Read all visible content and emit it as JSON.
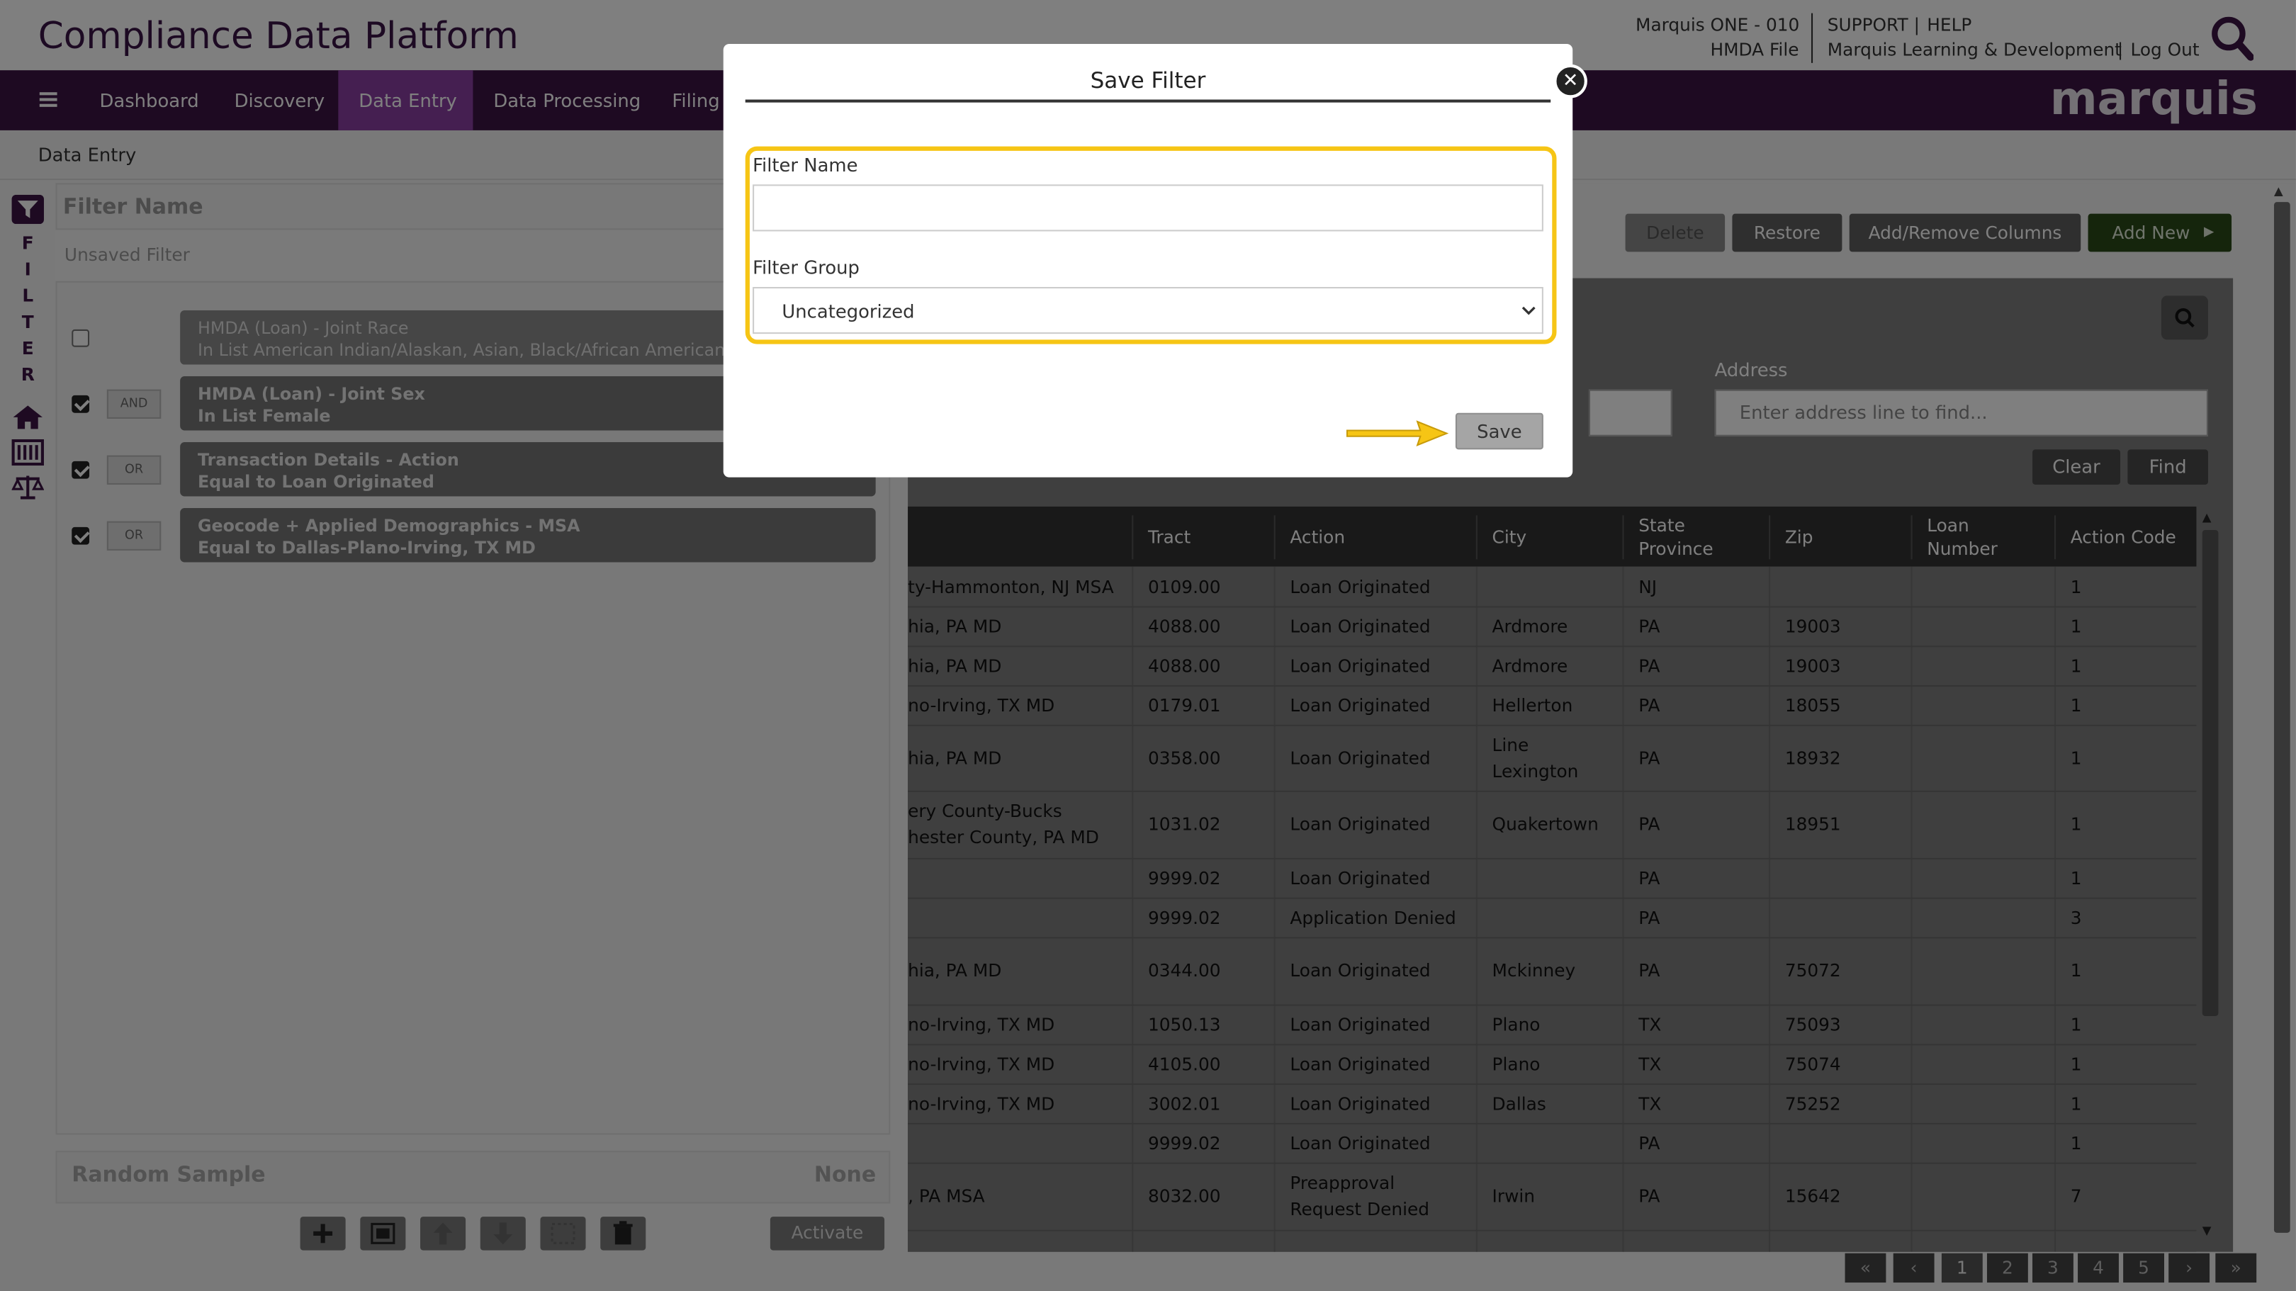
{
  "header": {
    "app_title": "Compliance Data Platform",
    "company": "Marquis ONE - 010",
    "file": "HMDA File",
    "support": "SUPPORT",
    "sep1": "|",
    "help": "HELP",
    "org": "Marquis Learning & Development",
    "sep2": "|",
    "logout": "Log Out"
  },
  "nav": {
    "items": [
      "Dashboard",
      "Discovery",
      "Data Entry",
      "Data Processing",
      "Filing"
    ],
    "active": "Data Entry",
    "logo": "marquis"
  },
  "breadcrumb": "Data Entry",
  "filter_panel": {
    "vertical_label": [
      "F",
      "I",
      "L",
      "T",
      "E",
      "R"
    ],
    "filter_name_label": "Filter Name",
    "filter_name_value": "Unsaved Filter",
    "criteria": [
      {
        "checked": false,
        "logic": "",
        "line1": "HMDA (Loan) - Joint Race",
        "line2": "In List American Indian/Alaskan, Asian, Black/African American, Haw"
      },
      {
        "checked": true,
        "logic": "AND",
        "line1": "HMDA (Loan) - Joint Sex",
        "line2": "In List Female"
      },
      {
        "checked": true,
        "logic": "OR",
        "line1": "Transaction Details - Action",
        "line2": "Equal to Loan Originated"
      },
      {
        "checked": true,
        "logic": "OR",
        "line1": "Geocode + Applied Demographics - MSA",
        "line2": "Equal to Dallas-Plano-Irving, TX MD"
      }
    ],
    "random_sample_label": "Random Sample",
    "random_sample_value": "None",
    "activate_label": "Activate"
  },
  "toolbar": {
    "delete": "Delete",
    "restore": "Restore",
    "add_remove_columns": "Add/Remove Columns",
    "add_new": "Add New"
  },
  "search_form": {
    "address_label": "Address",
    "address_placeholder": "Enter address line to find...",
    "clear": "Clear",
    "find": "Find"
  },
  "table": {
    "columns": [
      "Tract",
      "Action",
      "City",
      "State Province",
      "Zip",
      "Loan Number",
      "Action Code"
    ],
    "rows": [
      {
        "msa": "ty-Hammonton, NJ MSA",
        "tract": "0109.00",
        "action": "Loan Originated",
        "city": "",
        "state": "NJ",
        "zip": "",
        "loan": "",
        "code": "1"
      },
      {
        "msa": "hia, PA MD",
        "tract": "4088.00",
        "action": "Loan Originated",
        "city": "Ardmore",
        "state": "PA",
        "zip": "19003",
        "loan": "",
        "code": "1"
      },
      {
        "msa": "hia, PA MD",
        "tract": "4088.00",
        "action": "Loan Originated",
        "city": "Ardmore",
        "state": "PA",
        "zip": "19003",
        "loan": "",
        "code": "1"
      },
      {
        "msa": "no-Irving, TX MD",
        "tract": "0179.01",
        "action": "Loan Originated",
        "city": "Hellerton",
        "state": "PA",
        "zip": "18055",
        "loan": "",
        "code": "1"
      },
      {
        "msa": "hia, PA MD",
        "tract": "0358.00",
        "action": "Loan Originated",
        "city": "Line Lexington",
        "state": "PA",
        "zip": "18932",
        "loan": "",
        "code": "1"
      },
      {
        "msa": "ery County-Bucks hester County, PA MD",
        "tract": "1031.02",
        "action": "Loan Originated",
        "city": "Quakertown",
        "state": "PA",
        "zip": "18951",
        "loan": "",
        "code": "1"
      },
      {
        "msa": "",
        "tract": "9999.02",
        "action": "Loan Originated",
        "city": "",
        "state": "PA",
        "zip": "",
        "loan": "",
        "code": "1"
      },
      {
        "msa": "",
        "tract": "9999.02",
        "action": "Application Denied",
        "city": "",
        "state": "PA",
        "zip": "",
        "loan": "",
        "code": "3"
      },
      {
        "msa": "hia, PA MD",
        "tract": "0344.00",
        "action": "Loan Originated",
        "city": "Mckinney",
        "state": "PA",
        "zip": "75072",
        "loan": "",
        "code": "1"
      },
      {
        "msa": "no-Irving, TX MD",
        "tract": "1050.13",
        "action": "Loan Originated",
        "city": "Plano",
        "state": "TX",
        "zip": "75093",
        "loan": "",
        "code": "1"
      },
      {
        "msa": "no-Irving, TX MD",
        "tract": "4105.00",
        "action": "Loan Originated",
        "city": "Plano",
        "state": "TX",
        "zip": "75074",
        "loan": "",
        "code": "1"
      },
      {
        "msa": "no-Irving, TX MD",
        "tract": "3002.01",
        "action": "Loan Originated",
        "city": "Dallas",
        "state": "TX",
        "zip": "75252",
        "loan": "",
        "code": "1"
      },
      {
        "msa": "",
        "tract": "9999.02",
        "action": "Loan Originated",
        "city": "",
        "state": "PA",
        "zip": "",
        "loan": "",
        "code": "1"
      },
      {
        "msa": ", PA MSA",
        "tract": "8032.00",
        "action": "Preapproval Request Denied",
        "city": "Irwin",
        "state": "PA",
        "zip": "15642",
        "loan": "",
        "code": "7"
      }
    ]
  },
  "pagination": [
    "«",
    "‹",
    "1",
    "2",
    "3",
    "4",
    "5",
    "›",
    "»"
  ],
  "modal": {
    "title": "Save Filter",
    "filter_name_label": "Filter Name",
    "filter_name_value": "",
    "filter_group_label": "Filter Group",
    "filter_group_value": "Uncategorized",
    "save_label": "Save",
    "highlight_color": "#f6c515"
  },
  "colors": {
    "brand_dark": "#3c1445",
    "nav_active": "#8a3fa3",
    "add_new_green": "#3d7a1f"
  }
}
